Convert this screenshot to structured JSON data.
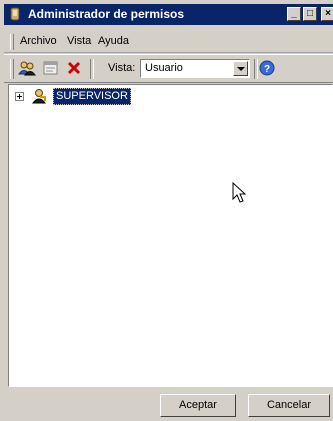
{
  "window": {
    "title": "Administrador de permisos",
    "controls": [
      "_",
      "□",
      "×"
    ]
  },
  "menubar": {
    "items": [
      "Archivo",
      "Vista",
      "Ayuda"
    ]
  },
  "toolbar": {
    "buttons": [
      "users-icon",
      "properties-icon",
      "delete-icon",
      "help-icon"
    ],
    "vista_label": "Vista:",
    "vista_value": "Usuario"
  },
  "tree": {
    "nodes": [
      {
        "label": "SUPERVISOR",
        "expanded": false,
        "selected": true
      }
    ]
  },
  "footer": {
    "accept_label": "Aceptar",
    "cancel_label": "Cancelar"
  }
}
